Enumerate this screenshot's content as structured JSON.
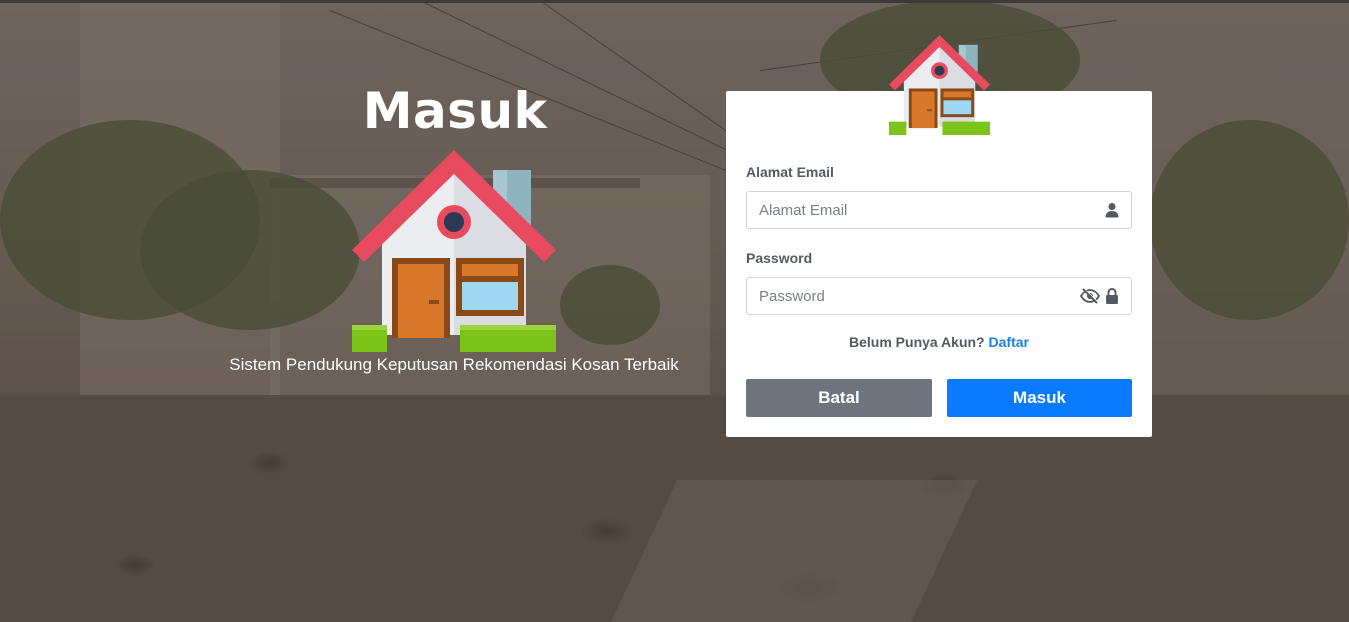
{
  "hero": {
    "title": "Masuk",
    "subtitle": "Sistem Pendukung Keputusan Rekomendasi Kosan Terbaik",
    "house_icon": "house-icon"
  },
  "form": {
    "email": {
      "label": "Alamat Email",
      "placeholder": "Alamat Email",
      "value": "",
      "icon": "user-icon"
    },
    "password": {
      "label": "Password",
      "placeholder": "Password",
      "value": "",
      "icons": [
        "eye-slash-icon",
        "lock-icon"
      ]
    },
    "signup_prompt": "Belum Punya Akun?",
    "signup_link": "Daftar",
    "cancel_label": "Batal",
    "submit_label": "Masuk"
  },
  "colors": {
    "primary": "#0a7bff",
    "secondary": "#6c757d",
    "link": "#1a7fe6",
    "roof": "#e84a5f",
    "door": "#d9782a",
    "grass": "#7cc31a"
  }
}
